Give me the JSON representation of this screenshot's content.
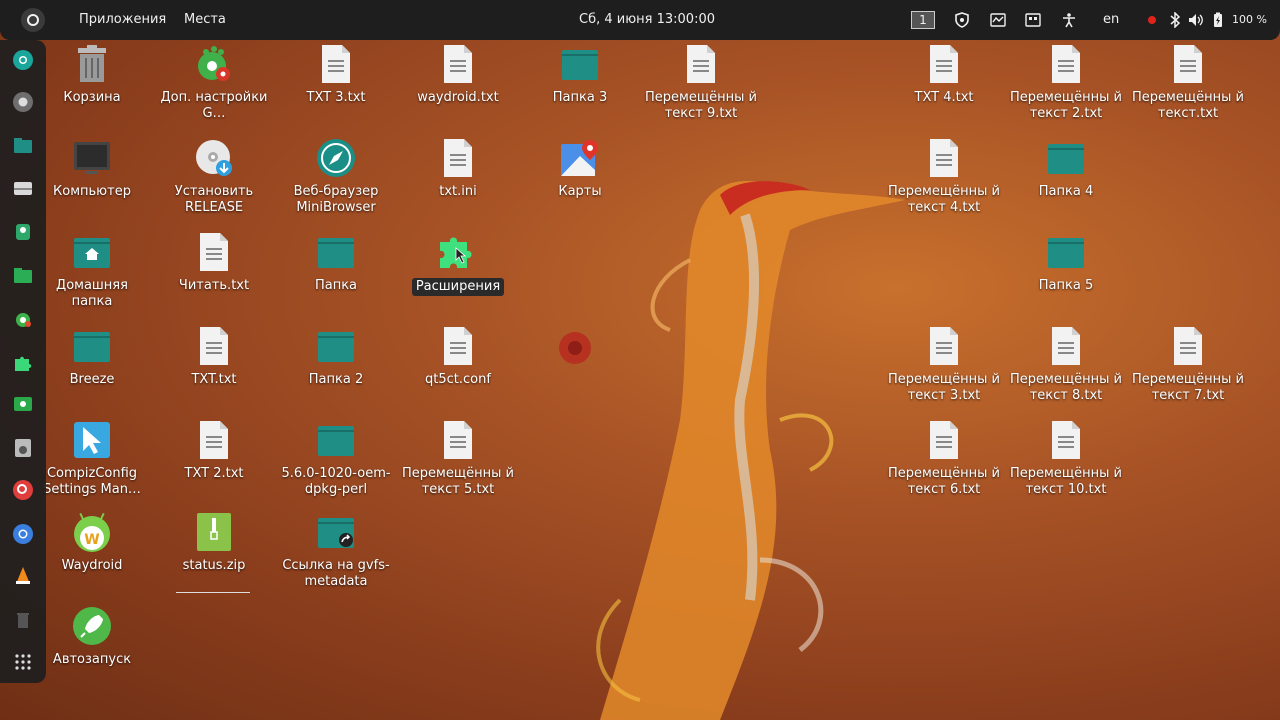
{
  "topbar": {
    "apps_label": "Приложения",
    "places_label": "Места",
    "clock": "Сб, 4 июня  13:00:00",
    "workspace": "1",
    "lang": "en",
    "battery": "100 %"
  },
  "dock": {
    "items": [
      "chromium-icon",
      "chrome-icon",
      "files-icon",
      "drive-icon",
      "tweaks-icon",
      "folder-icon",
      "gnome-icon",
      "extensions-icon",
      "video-icon",
      "software-icon",
      "search-icon",
      "chromium2-icon",
      "vlc-icon",
      "trash-icon",
      "apps-grid-icon"
    ]
  },
  "desktop": {
    "trash": "Корзина",
    "gnome_tweaks": "Доп. настройки G…",
    "txt3": "TXT 3.txt",
    "waydroid_txt": "waydroid.txt",
    "folder3": "Папка 3",
    "moved9": "Перемещённы й текст 9.txt",
    "txt4": "TXT 4.txt",
    "moved2": "Перемещённы й текст 2.txt",
    "moved": "Перемещённы й текст.txt",
    "computer": "Компьютер",
    "install_release": "Установить RELEASE",
    "minibrowser": "Веб-браузер MiniBrowser",
    "txt_ini": "txt.ini",
    "maps": "Карты",
    "moved4": "Перемещённы й текст 4.txt",
    "folder4": "Папка 4",
    "home": "Домашняя папка",
    "read_txt": "Читать.txt",
    "folder": "Папка",
    "extensions": "Расширения",
    "folder5": "Папка 5",
    "breeze": "Breeze",
    "txt_txt": "TXT.txt",
    "folder2": "Папка 2",
    "qt5ct": "qt5ct.conf",
    "moved3": "Перемещённы й текст 3.txt",
    "moved8": "Перемещённы й текст 8.txt",
    "moved7": "Перемещённы й текст 7.txt",
    "compiz": "CompizConfig Settings Man…",
    "txt2": "TXT 2.txt",
    "oem_dpkg": "5.6.0-1020-oem-dpkg-perl",
    "moved5": "Перемещённы й текст 5.txt",
    "moved6": "Перемещённы й текст 6.txt",
    "moved10": "Перемещённы й текст 10.txt",
    "waydroid": "Waydroid",
    "status_zip": "status.zip",
    "gvfs_link": "Ссылка на gvfs-metadata",
    "autostart": "Автозапуск"
  },
  "colors": {
    "folder": "#1f8e84",
    "topbar": "#1e1e1e",
    "accent": "#e95420"
  }
}
